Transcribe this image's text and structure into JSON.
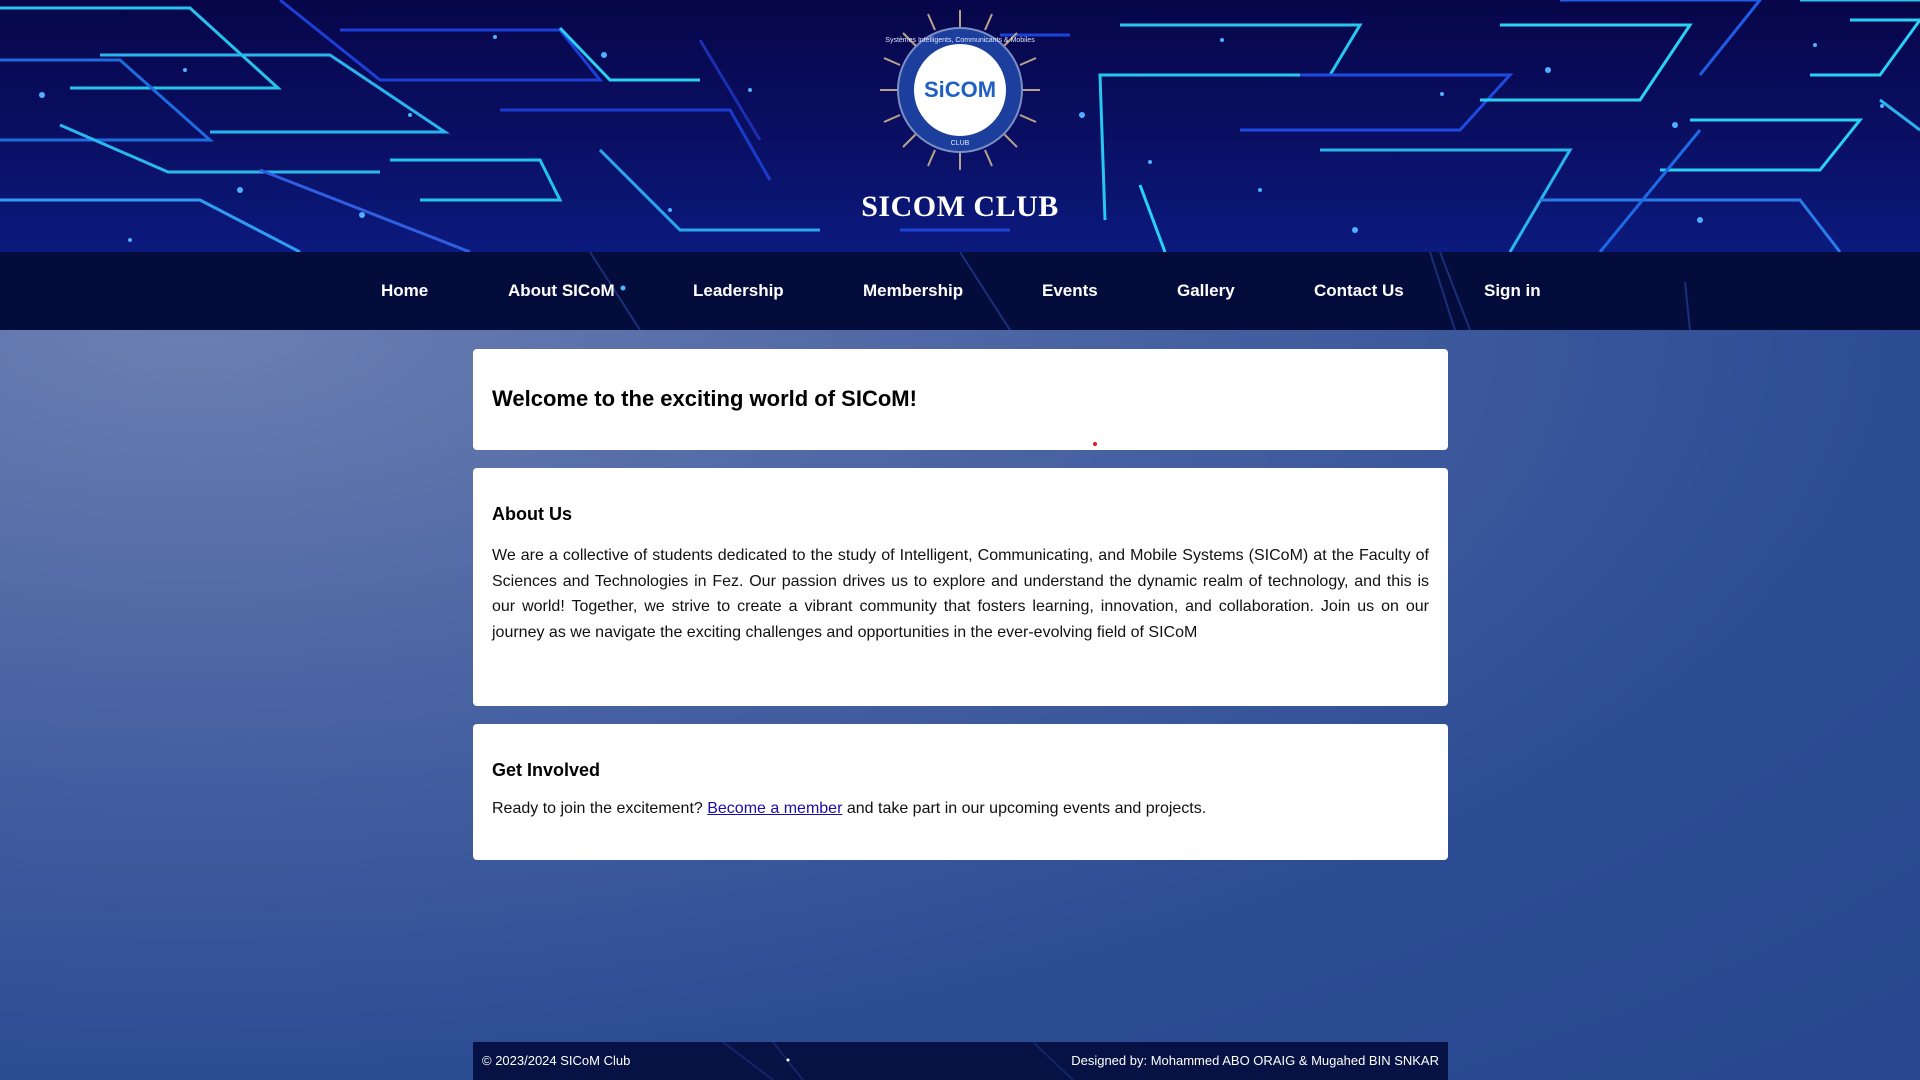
{
  "header": {
    "site_title": "SICOM CLUB",
    "logo": {
      "name": "SiCOM",
      "ring_text": "Systèmes Intelligents, Communicants & Mobiles",
      "sub_text": "CLUB"
    }
  },
  "nav": {
    "items": [
      {
        "label": "Home"
      },
      {
        "label": "About SICoM"
      },
      {
        "label": "Leadership"
      },
      {
        "label": "Membership"
      },
      {
        "label": "Events"
      },
      {
        "label": "Gallery"
      },
      {
        "label": "Contact Us"
      },
      {
        "label": "Sign in"
      }
    ]
  },
  "welcome": {
    "heading": "Welcome to the exciting world of SICoM!"
  },
  "about": {
    "heading": "About Us",
    "text": "We are a collective of students dedicated to the study of Intelligent, Communicating, and Mobile Systems (SICoM) at the Faculty of Sciences and Technologies in Fez. Our passion drives us to explore and understand the dynamic realm of technology, and this is our world! Together, we strive to create a vibrant community that fosters learning, innovation, and collaboration. Join us on our journey as we navigate the exciting challenges and opportunities in the ever-evolving field of SICoM"
  },
  "get_involved": {
    "heading": "Get Involved",
    "text_before": "Ready to join the excitement? ",
    "link_label": "Become a member",
    "text_after": " and take part in our upcoming events and projects."
  },
  "footer": {
    "copyright": "© 2023/2024 SICoM Club",
    "designer": "Designed by: Mohammed ABO ORAIG & Mugahed BIN SNKAR"
  },
  "colors": {
    "header_bg": "#07064a",
    "nav_bg": "#040c3c",
    "circuit_cyan": "#1ec8f0",
    "link": "#1a0dab",
    "footer_bg": "#061244"
  }
}
